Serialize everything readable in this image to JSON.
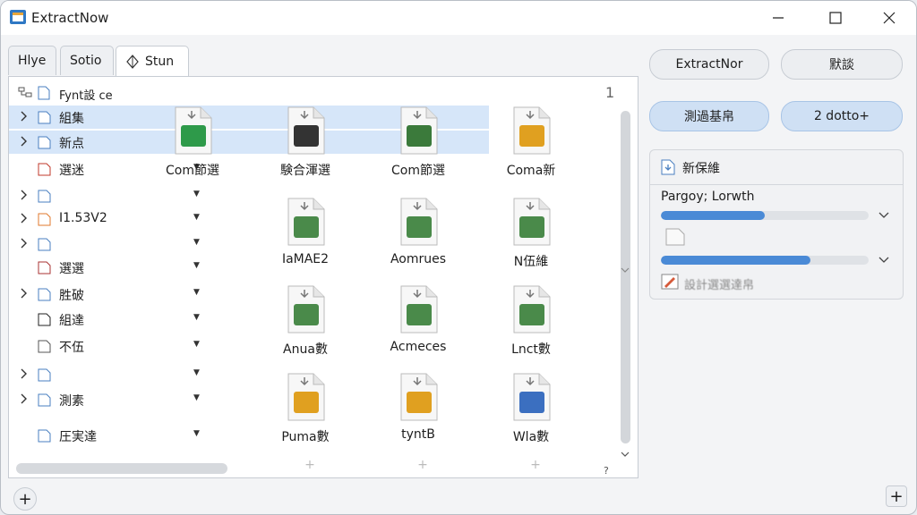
{
  "window": {
    "title": "ExtractNow"
  },
  "tabs": [
    {
      "label": "Hlye"
    },
    {
      "label": "Sotio"
    },
    {
      "label": "Stun",
      "active": true
    }
  ],
  "tree": {
    "header_label": "Fynt設 ce",
    "header_count": "1",
    "rows": [
      {
        "label": "組集",
        "selected": true,
        "expander": true,
        "icon": "checkmark-doc-icon"
      },
      {
        "label": "新点",
        "selected": true,
        "expander": true,
        "icon": "doc-icon"
      },
      {
        "label": "選迷",
        "expander": false,
        "icon": "red-triangle-icon"
      },
      {
        "label": "",
        "expander": true,
        "icon": "folder-icon"
      },
      {
        "label": "I1.53V2",
        "expander": true,
        "icon": "cross-icon"
      },
      {
        "label": "",
        "expander": true,
        "icon": "folder-icon"
      },
      {
        "label": "選選",
        "expander": false,
        "icon": "t-icon"
      },
      {
        "label": "胜破",
        "expander": true,
        "icon": "folder-icon"
      },
      {
        "label": "組達",
        "expander": false,
        "icon": "black-box-icon"
      },
      {
        "label": "不伍",
        "expander": false,
        "icon": "gray-box-icon"
      },
      {
        "label": "",
        "expander": true,
        "icon": "folder-icon"
      },
      {
        "label": "測素",
        "expander": true,
        "icon": "doc-icon"
      },
      {
        "label": "圧実達",
        "expander": false,
        "icon": "folder-icon"
      }
    ]
  },
  "files": [
    {
      "label": "Com節選",
      "icon": "green-check-icon"
    },
    {
      "label": "験合渾選",
      "icon": "black-cube-icon"
    },
    {
      "label": "Com節選",
      "icon": "terminal-icon"
    },
    {
      "label": "Coma新",
      "icon": "yellow-gear-icon"
    },
    {
      "label": "IaMAE2",
      "icon": "image-doc-icon"
    },
    {
      "label": "Aomrues",
      "icon": "image-doc-icon"
    },
    {
      "label": "N伍維",
      "icon": "image-doc-icon"
    },
    {
      "label": "Anua數",
      "icon": "image-doc-icon"
    },
    {
      "label": "Acmeces",
      "icon": "image-doc-icon"
    },
    {
      "label": "Lnct數",
      "icon": "image-doc-icon"
    },
    {
      "label": "Puma數",
      "icon": "yellow-gear-icon"
    },
    {
      "label": "tyntB",
      "icon": "yellow-gear-icon"
    },
    {
      "label": "Wla數",
      "icon": "blue-text-doc-icon"
    }
  ],
  "right": {
    "btn_extract": "ExtractNor",
    "btn_second": "默談",
    "btn_third": "測過基帛",
    "btn_fourth": "2 dotto+",
    "panel_title": "新保維",
    "progress_label": "Pargoy; Lorwth",
    "progress1": 0.5,
    "progress2": 0.72,
    "status_text": "設計選選達帛"
  },
  "bottom": {
    "add_label": "+",
    "add_right_label": "+"
  },
  "colors": {
    "accent": "#4a8ad6",
    "selection": "#d6e6f9"
  }
}
